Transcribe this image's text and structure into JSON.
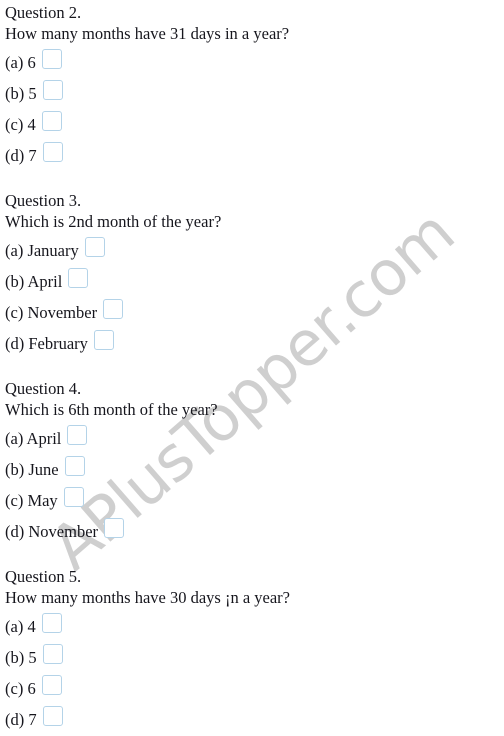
{
  "document": {
    "watermark": "APlusTopper.com",
    "watermark_color": "#cfcfcf",
    "text_color": "#16161d",
    "checkbox_border_color": "#b4d3e8",
    "background_color": "#ffffff"
  },
  "questions": [
    {
      "title": "Question 2.",
      "prompt": "How many months have 31 days in a year?",
      "options": [
        {
          "label": "(a) 6"
        },
        {
          "label": "(b) 5"
        },
        {
          "label": "(c) 4"
        },
        {
          "label": "(d) 7"
        }
      ]
    },
    {
      "title": "Question 3.",
      "prompt": "Which is 2nd month of the year?",
      "options": [
        {
          "label": "(a) January"
        },
        {
          "label": "(b) April"
        },
        {
          "label": "(c) November"
        },
        {
          "label": "(d) February"
        }
      ]
    },
    {
      "title": "Question 4.",
      "prompt": "Which is 6th month of the year?",
      "options": [
        {
          "label": "(a) April"
        },
        {
          "label": "(b) June"
        },
        {
          "label": "(c) May"
        },
        {
          "label": "(d) November"
        }
      ]
    },
    {
      "title": "Question 5.",
      "prompt": "How many months have 30 days ¡n a year?",
      "options": [
        {
          "label": "(a) 4"
        },
        {
          "label": "(b) 5"
        },
        {
          "label": "(c) 6"
        },
        {
          "label": "(d) 7"
        }
      ]
    }
  ]
}
